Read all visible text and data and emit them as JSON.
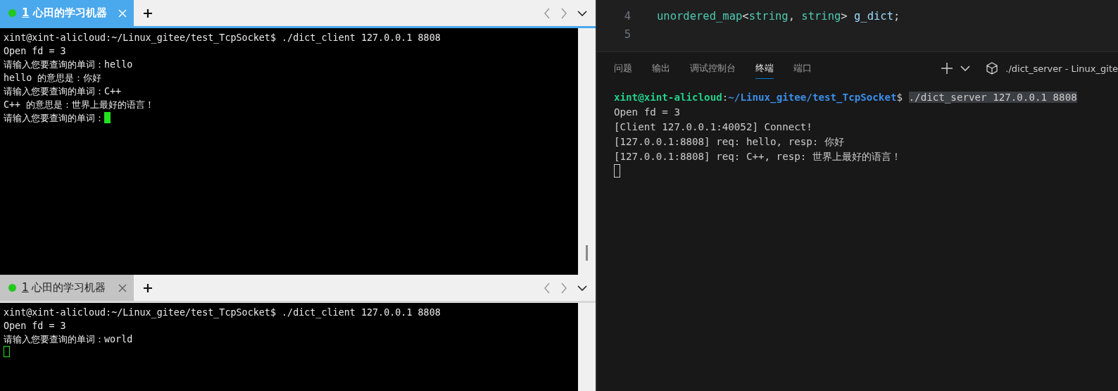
{
  "client_terminals": [
    {
      "tab": {
        "index": "1",
        "title": "心田的学习机器",
        "selected": true
      },
      "lines": [
        "xint@xint-alicloud:~/Linux_gitee/test_TcpSocket$ ./dict_client 127.0.0.1 8808",
        "Open fd = 3",
        "请输入您要查询的单词：hello",
        "hello 的意思是：你好",
        "请输入您要查询的单词：C++",
        "C++ 的意思是：世界上最好的语言！",
        "请输入您要查询的单词："
      ],
      "cursor": {
        "focused": true,
        "new_line": false
      }
    },
    {
      "tab": {
        "index": "1",
        "title": "心田的学习机器",
        "selected": false
      },
      "lines": [
        "xint@xint-alicloud:~/Linux_gitee/test_TcpSocket$ ./dict_client 127.0.0.1 8808",
        "Open fd = 3",
        "请输入您要查询的单词：world"
      ],
      "cursor": {
        "focused": false,
        "new_line": true
      }
    }
  ],
  "editor": {
    "lines": [
      {
        "number": "4",
        "tokens": [
          {
            "text": "unordered_map",
            "color": "#4ec9b0"
          },
          {
            "text": "<",
            "color": "#d4d4d4"
          },
          {
            "text": "string",
            "color": "#4ec9b0"
          },
          {
            "text": ", ",
            "color": "#d4d4d4"
          },
          {
            "text": "string",
            "color": "#4ec9b0"
          },
          {
            "text": "> ",
            "color": "#d4d4d4"
          },
          {
            "text": "g_dict",
            "color": "#9cdcfe"
          },
          {
            "text": ";",
            "color": "#d4d4d4"
          }
        ]
      },
      {
        "number": "5"
      }
    ]
  },
  "panel": {
    "tabs": [
      {
        "label": "问题",
        "selected": false
      },
      {
        "label": "输出",
        "selected": false
      },
      {
        "label": "调试控制台",
        "selected": false
      },
      {
        "label": "终端",
        "selected": true
      },
      {
        "label": "端口",
        "selected": false
      }
    ],
    "terminal_name": "./dict_server - Linux_gite"
  },
  "server_terminal": {
    "lines": [
      {
        "kind": "prompt",
        "user": "xint@xint-alicloud",
        "separator": ":",
        "path": "~/Linux_gitee/test_TcpSocket",
        "sign": "$",
        "command": "./dict_server 127.0.0.1 8808",
        "selected": true
      },
      {
        "kind": "output",
        "text": "Open fd = 3"
      },
      {
        "kind": "output",
        "text": "[Client 127.0.0.1:40052] Connect!"
      },
      {
        "kind": "output",
        "text": "[127.0.0.1:8808] req: hello, resp: 你好"
      },
      {
        "kind": "output",
        "text": "[127.0.0.1:8808] req: C++, resp: 世界上最好的语言！"
      }
    ],
    "cursor": {
      "focused": false,
      "new_line": true
    }
  }
}
